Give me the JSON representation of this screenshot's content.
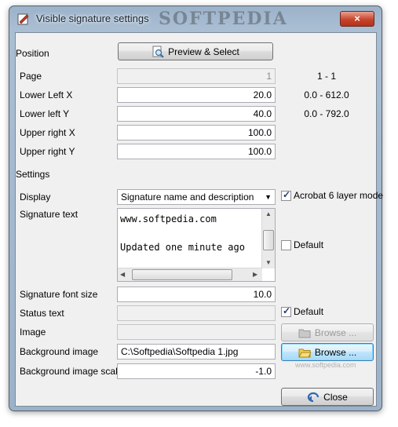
{
  "window": {
    "title": "Visible signature settings",
    "watermark": "SOFTPEDIA",
    "close_glyph": "×"
  },
  "position": {
    "section_label": "Position",
    "preview_button": "Preview & Select",
    "page": {
      "label": "Page",
      "value": "1",
      "range": "1 - 1"
    },
    "lower_left_x": {
      "label": "Lower Left X",
      "value": "20.0",
      "range": "0.0 - 612.0"
    },
    "lower_left_y": {
      "label": "Lower left Y",
      "value": "40.0",
      "range": "0.0 - 792.0"
    },
    "upper_right_x": {
      "label": "Upper right X",
      "value": "100.0"
    },
    "upper_right_y": {
      "label": "Upper right Y",
      "value": "100.0"
    }
  },
  "settings": {
    "section_label": "Settings",
    "display": {
      "label": "Display",
      "selected": "Signature name and description"
    },
    "acrobat_checkbox": {
      "label": "Acrobat 6 layer mode",
      "checked": true
    },
    "signature_text": {
      "label": "Signature text",
      "line1": "www.softpedia.com",
      "line2": "Updated one minute ago"
    },
    "signature_text_default": {
      "label": "Default",
      "checked": false
    },
    "font_size": {
      "label": "Signature font size",
      "value": "10.0"
    },
    "status_text": {
      "label": "Status text",
      "value": ""
    },
    "status_default": {
      "label": "Default",
      "checked": true
    },
    "image": {
      "label": "Image",
      "value": "",
      "browse_label": "Browse ..."
    },
    "background_image": {
      "label": "Background image",
      "value": "C:\\Softpedia\\Softpedia 1.jpg",
      "browse_label": "Browse ..."
    },
    "background_scale": {
      "label": "Background image scale",
      "value": "-1.0"
    },
    "close_button": "Close",
    "watermark_url": "www.softpedia.com"
  },
  "icons": [
    "app-icon",
    "preview-icon",
    "folder-icon",
    "close-door-icon"
  ]
}
